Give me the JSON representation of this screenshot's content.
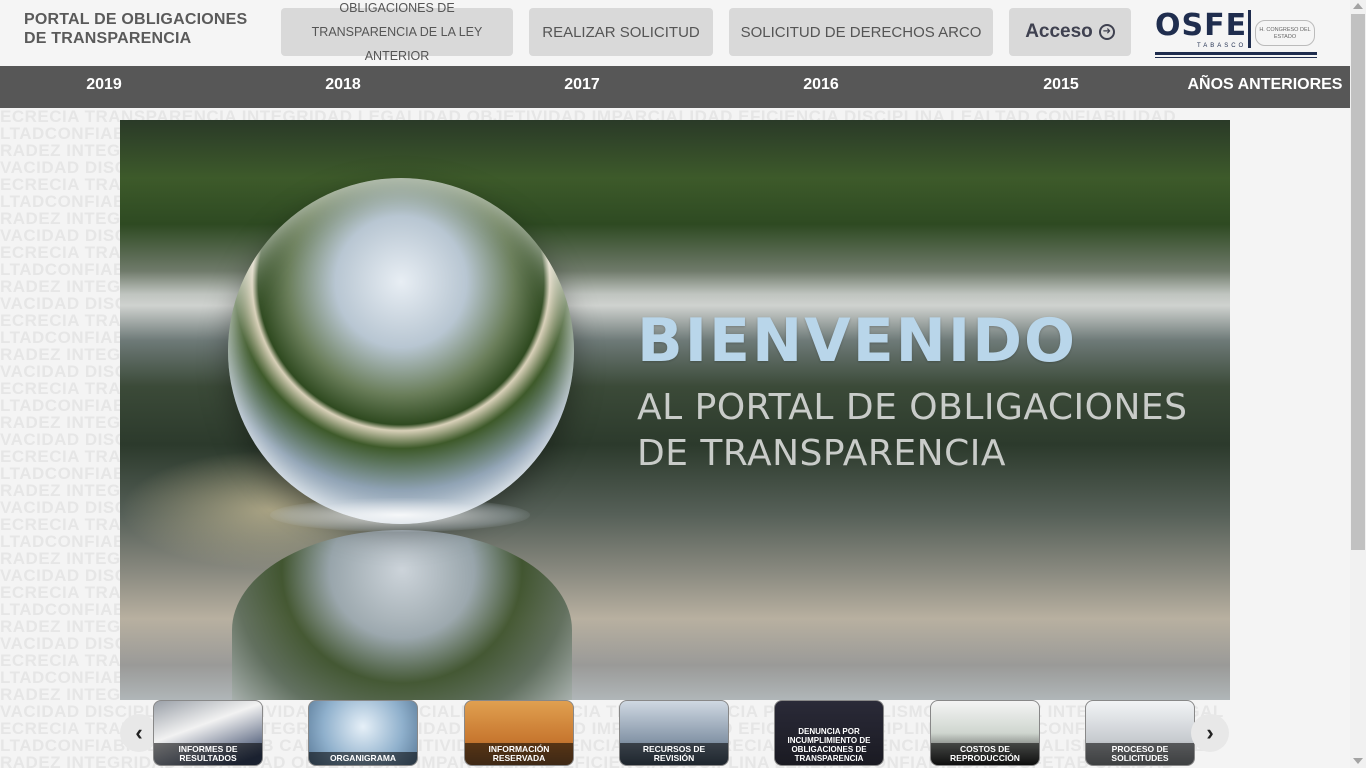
{
  "header": {
    "portal_title": "PORTAL DE OBLIGACIONES DE TRANSPARENCIA",
    "buttons": {
      "ley_anterior": "OBLIGACIONES DE TRANSPARENCIA DE LA LEY ANTERIOR",
      "realizar_solicitud": "REALIZAR SOLICITUD",
      "derechos_arco": "SOLICITUD DE DERECHOS ARCO",
      "acceso": "Acceso"
    },
    "logo": {
      "text": "OSFE",
      "subtext": "TABASCO",
      "congreso": "H. CONGRESO DEL ESTADO"
    }
  },
  "years": [
    "2019",
    "2018",
    "2017",
    "2016",
    "2015",
    "AÑOS ANTERIORES"
  ],
  "watermark_lines": [
    "ECRECIA TRANSPARENCIA INTEGRIDAD LEGALIDAD OBJETIVIDAD IMPARCIALIDAD EFICIENCIA DISCIPLINA LEALTAD CONFIABILIDAD",
    "LTADCONFIABILIDAD OSFETAB CALIDAD DEFINITIVIDAD CONFIDENCIALIDAD SECRECIA TRANSPARENCIA PROFESIONALISMO HONRADEZ",
    "RADEZ INTEGRIDAD LEGALIDAD OBJETIVIDAD IMPARCIALIDAD EFICIENCIA DISCIPLINA LEALTAD CONFIABILIDAD OSFETAB CALIDAD",
    "VACIDAD DISCIPLINA DEFINITIVIDAD CONFIDENCIALIDAD SECRECIA TRANSPARENCIA PROFESIONALISMO HONRADEZ INTEGRIDAD LEGAL"
  ],
  "hero": {
    "headline": "BIENVENIDO",
    "subheadline": "AL PORTAL DE OBLIGACIONES DE TRANSPARENCIA"
  },
  "carousel": {
    "items": [
      "INFORMES DE RESULTADOS",
      "ORGANIGRAMA",
      "INFORMACIÓN RESERVADA",
      "RECURSOS DE REVISIÓN",
      "DENUNCIA POR INCUMPLIMIENTO DE OBLIGACIONES DE TRANSPARENCIA",
      "COSTOS DE REPRODUCCIÓN",
      "PROCESO DE SOLICITUDES"
    ],
    "prev_icon": "chevron-left-icon",
    "next_icon": "chevron-right-icon"
  },
  "colors": {
    "yearbar": "#575757",
    "button_bg": "#d9d9d9",
    "logo_navy": "#1f2d4e",
    "hero_headline": "#b9d6ea"
  }
}
